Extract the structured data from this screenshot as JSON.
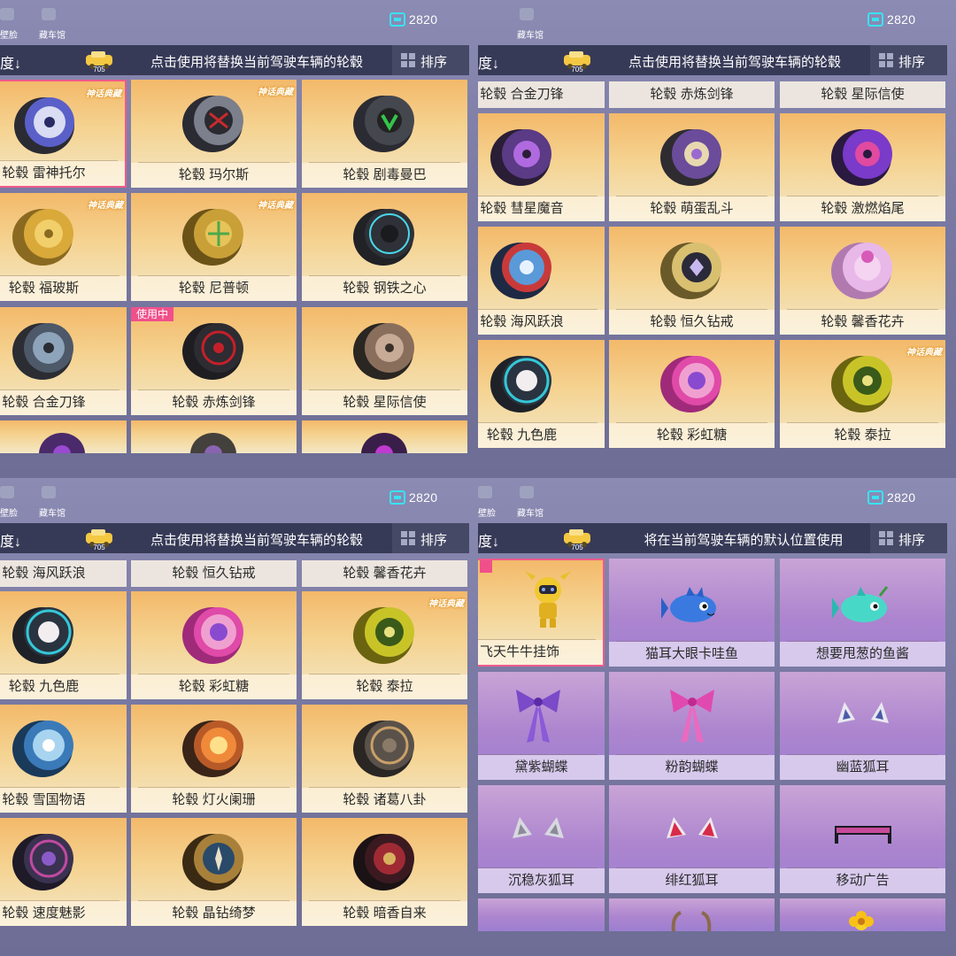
{
  "colors": {
    "accent_pink": "#f0508a",
    "coin": "#39e2f2",
    "gold_card": "#f5d391",
    "purple_card": "#ad85cf"
  },
  "panels": [
    {
      "top_left_label_1": "壁脸",
      "top_left_label_2": "藏车馆",
      "coins": "2820",
      "sort_left": "度↓",
      "car_badge": "705",
      "hint": "点击使用将替换当前驾驶车辆的轮毂",
      "sort_label": "排序",
      "items": [
        {
          "label": "轮毂 雷神托尔",
          "badge": "神话典藏"
        },
        {
          "label": "轮毂 玛尔斯",
          "badge": "神话典藏"
        },
        {
          "label": "轮毂 剧毒曼巴"
        },
        {
          "label": "轮毂 福玻斯",
          "badge": "神话典藏"
        },
        {
          "label": "轮毂 尼普顿",
          "badge": "神话典藏"
        },
        {
          "label": "轮毂 钢铁之心"
        },
        {
          "label": "轮毂 合金刀锋"
        },
        {
          "label": "轮毂 赤炼剑锋",
          "status": "使用中"
        },
        {
          "label": "轮毂 星际信使"
        }
      ]
    },
    {
      "top_left_label_2": "藏车馆",
      "coins": "2820",
      "sort_left": "度↓",
      "car_badge": "705",
      "hint": "点击使用将替换当前驾驶车辆的轮毂",
      "sort_label": "排序",
      "strip": [
        "轮毂 合金刀锋",
        "轮毂 赤炼剑锋",
        "轮毂 星际信使"
      ],
      "items": [
        {
          "label": "轮毂 彗星魔音"
        },
        {
          "label": "轮毂 萌蛋乱斗"
        },
        {
          "label": "轮毂 激燃焰尾"
        },
        {
          "label": "轮毂 海风跃浪"
        },
        {
          "label": "轮毂 恒久钻戒"
        },
        {
          "label": "轮毂 馨香花卉"
        },
        {
          "label": "轮毂 九色鹿"
        },
        {
          "label": "轮毂 彩虹糖"
        },
        {
          "label": "轮毂 泰拉",
          "badge": "神话典藏"
        }
      ]
    },
    {
      "top_left_label_1": "壁脸",
      "top_left_label_2": "藏车馆",
      "coins": "2820",
      "sort_left": "度↓",
      "car_badge": "705",
      "hint": "点击使用将替换当前驾驶车辆的轮毂",
      "sort_label": "排序",
      "strip": [
        "轮毂 海风跃浪",
        "轮毂 恒久钻戒",
        "轮毂 馨香花卉"
      ],
      "items": [
        {
          "label": "轮毂 九色鹿"
        },
        {
          "label": "轮毂 彩虹糖"
        },
        {
          "label": "轮毂 泰拉",
          "badge": "神话典藏"
        },
        {
          "label": "轮毂 雪国物语"
        },
        {
          "label": "轮毂 灯火阑珊"
        },
        {
          "label": "轮毂 诸葛八卦"
        },
        {
          "label": "轮毂 速度魅影"
        },
        {
          "label": "轮毂 晶钻绮梦"
        },
        {
          "label": "轮毂 暗香自来"
        }
      ]
    },
    {
      "top_left_label_1": "壁脸",
      "top_left_label_2": "藏车馆",
      "coins": "2820",
      "sort_left": "度↓",
      "car_badge": "705",
      "hint": "将在当前驾驶车辆的默认位置使用",
      "sort_label": "排序",
      "items": [
        {
          "label": "飞天牛牛挂饰"
        },
        {
          "label": "猫耳大眼卡哇鱼"
        },
        {
          "label": "想要甩葱的鱼酱"
        },
        {
          "label": "黛紫蝴蝶"
        },
        {
          "label": "粉韵蝴蝶"
        },
        {
          "label": "幽蓝狐耳"
        },
        {
          "label": "沉稳灰狐耳"
        },
        {
          "label": "绯红狐耳"
        },
        {
          "label": "移动广告"
        }
      ]
    }
  ]
}
